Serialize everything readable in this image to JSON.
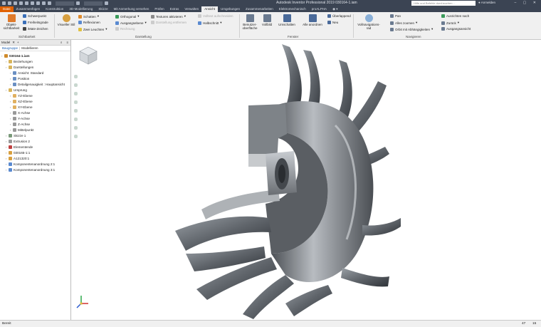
{
  "window": {
    "title": "Autodesk Inventor Professional 2019   030164-1.iam",
    "search_placeholder": "Hilfe und Befehle durchsuchen...",
    "user_label": "Anmelden"
  },
  "menu_tabs": [
    "Datei",
    "Zusammenfügen",
    "Konstruktion",
    "3D-Modellierung",
    "Skizze",
    "Mit Anmerkung versehen",
    "Prüfen",
    "Extras",
    "Verwalten",
    "Ansicht",
    "Umgebungen",
    "Zusammenarbeiten",
    "Elektromechanisch",
    "proALPHA"
  ],
  "ribbon": {
    "sichtbarkeit": {
      "objekt_label": "Objekt-\nsichtbarkeit",
      "schwerpunkt": "Schwerpunkt",
      "freiheitsgrade": "Freiheitsgrade",
      "imate": "iMate-Zeichen",
      "panel_label": "Sichtbarkeit"
    },
    "darstellung": {
      "visueller_stil": "Visueller Stil",
      "schatten": "Schatten",
      "reflexionen": "Reflexionen",
      "zwei_leuchten": "Zwei Leuchten",
      "orthogonal": "Orthogonal",
      "ausgangsebene": "Ausgangsebene",
      "rechnung": "Rechnung",
      "texturen": "Texturen aktivieren",
      "darstellung_entfernen": "Darstellung entfernen",
      "volltext_aufschneiden": "Volltext aufschneiden",
      "halbschnitt": "Halbschnitt",
      "panel_label": "Darstellung"
    },
    "fenster": {
      "benutzeroberflaeche": "Benutzer-\noberfläche",
      "vollbild": "Vollbild",
      "umschalten": "Umschalten",
      "alle_anordnen": "Alle anordnen",
      "ueberlappend": "Überlappend",
      "neu": "Neu",
      "panel_label": "Fenster"
    },
    "navigieren": {
      "navigationsrad": "Vollnavigations-\nrad",
      "pan": "Pan",
      "alles_zoomen": "Alles zoomen",
      "orbit": "Orbit mit Abhängigkeiten",
      "ausrichten": "Ausrichten nach",
      "zurueck": "Zurück",
      "ausgangsansicht": "Ausgangsansicht",
      "panel_label": "Navigieren"
    }
  },
  "browser": {
    "header": "Model",
    "tab_baugruppe": "Baugruppe",
    "tab_modellieren": "Modellieren",
    "nodes": [
      {
        "label": "030164-1.iam",
        "level": 0,
        "color": "#d08a2a",
        "bold": true
      },
      {
        "label": "Beziehungen",
        "level": 1,
        "color": "#d8b45a"
      },
      {
        "label": "Darstellungen",
        "level": 1,
        "color": "#d8b45a"
      },
      {
        "label": "Ansicht: Standard",
        "level": 2,
        "color": "#6a8fc2"
      },
      {
        "label": "Position",
        "level": 2,
        "color": "#6a8fc2"
      },
      {
        "label": "Detailgenauigkeit : Hauptansicht",
        "level": 2,
        "color": "#6a8fc2"
      },
      {
        "label": "Ursprung",
        "level": 1,
        "color": "#d8b45a"
      },
      {
        "label": "YZ-Ebene",
        "level": 2,
        "color": "#e0b060"
      },
      {
        "label": "XZ-Ebene",
        "level": 2,
        "color": "#e0b060"
      },
      {
        "label": "XY-Ebene",
        "level": 2,
        "color": "#e0b060"
      },
      {
        "label": "X-Achse",
        "level": 2,
        "color": "#999999"
      },
      {
        "label": "Y-Achse",
        "level": 2,
        "color": "#999999"
      },
      {
        "label": "Z-Achse",
        "level": 2,
        "color": "#999999"
      },
      {
        "label": "Mittelpunkt",
        "level": 2,
        "color": "#999999"
      },
      {
        "label": "Skizze 1",
        "level": 1,
        "color": "#7a9a7a"
      },
      {
        "label": "Extrusion 2",
        "level": 1,
        "color": "#9a9a9a"
      },
      {
        "label": "Elementende",
        "level": 1,
        "color": "#c04040"
      },
      {
        "label": "030165-1:1",
        "level": 1,
        "color": "#d8a040"
      },
      {
        "label": "A121320:1",
        "level": 1,
        "color": "#d8a040"
      },
      {
        "label": "Komponentenanordnung 2:1",
        "level": 1,
        "color": "#5a8ad0"
      },
      {
        "label": "Komponentenanordnung 3:1",
        "level": 1,
        "color": "#5a8ad0"
      }
    ]
  },
  "status": {
    "text": "Bereit",
    "num1": "47",
    "num2": "15"
  },
  "colors": {
    "titlebar": "#3b4453",
    "file_tab": "#e06000",
    "ribbon": "#f0f0f0",
    "canvas": "#ffffff",
    "part_metal": "#6f747a"
  }
}
